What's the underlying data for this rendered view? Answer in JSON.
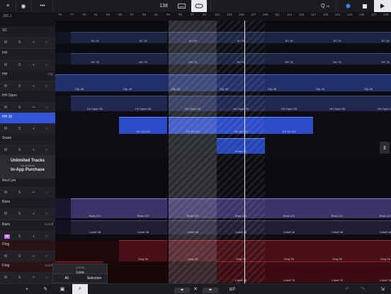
{
  "toolbar": {
    "menu_icon": "≡",
    "settings_icon": "◉",
    "more_icon": "•••",
    "tempo": "138",
    "time_sig_q": "Q",
    "time_sig_val": "16",
    "record_color": "#4a7cff"
  },
  "position_readout": "385.1",
  "ruler_ticks": [
    "75",
    "77",
    "79",
    "81",
    "83",
    "85",
    "87",
    "89",
    "91",
    "93",
    "95",
    "97",
    "99",
    "101",
    "103",
    "105",
    "107",
    "109",
    "111",
    "113",
    "115",
    "117",
    "119",
    "121",
    "123",
    "125",
    "127",
    "129"
  ],
  "tracks": [
    {
      "name": "SC",
      "clip_tag": "",
      "mute": "M",
      "solo": "S",
      "color": "#2a3a66"
    },
    {
      "name": "HH",
      "clip_tag": "",
      "mute": "M",
      "solo": "S",
      "color": "#2a3a66"
    },
    {
      "name": "HH",
      "clip_tag": "Clip",
      "mute": "M",
      "solo": "S",
      "color": "#3250a0"
    },
    {
      "name": "HH Open",
      "clip_tag": "",
      "mute": "M",
      "solo": "S",
      "color": "#2a3a66"
    },
    {
      "name": "HH 16",
      "clip_tag": "",
      "mute": "M",
      "solo": "S",
      "color": "#4a6fe8"
    },
    {
      "name": "Snare",
      "clip_tag": "",
      "mute": "M",
      "solo": "S",
      "color": "#2a3a66"
    },
    {
      "name": "RevCym",
      "clip_tag": "",
      "mute": "M",
      "solo": "S",
      "color": "#2a3a66"
    },
    {
      "name": "Bass",
      "clip_tag": "",
      "mute": "M",
      "solo": "S",
      "color": "#5a4a90"
    },
    {
      "name": "Bass",
      "clip_tag": "Cutoff",
      "mute": "M",
      "solo": "S",
      "color": "#5a4a90"
    },
    {
      "name": "Ding",
      "clip_tag": "",
      "mute": "M",
      "solo": "S",
      "color": "#8a1c24"
    },
    {
      "name": "Ding",
      "clip_tag": "Cutoff",
      "mute": "M",
      "solo": "S",
      "color": "#8a1c24"
    }
  ],
  "promo": {
    "line1": "Unlimited Tracks",
    "line2": "via onetime",
    "line3": "In-App Purchase"
  },
  "clip_labels": {
    "sc": "SC 15",
    "hh": "HH 76",
    "clip": "Clip 45",
    "hhopen": "HH Open 55",
    "hh16": "HH 16 103",
    "snare": "Snare 43",
    "bass": "Bass 113",
    "cutoff": "Cutoff 48",
    "ding": "Ding 36",
    "cutoff_ding": "Cutoff 78",
    "cutoff_ding2": "Cutoff 145"
  },
  "zoom_panel": {
    "title": "ZOOM",
    "loop": "Loop",
    "all": "All",
    "selection": "Selection"
  },
  "bottom": {
    "add": "+",
    "wand": "✎",
    "select": "▣",
    "zoom": "⌕",
    "close": "✕",
    "add_track": "⊞+",
    "clone": "⊟P",
    "undo": "↶",
    "redo": "↷",
    "resize": "⇲"
  },
  "nudge": {
    "left": "◂▸",
    "right": "◂▸"
  },
  "scroll": "⇕"
}
